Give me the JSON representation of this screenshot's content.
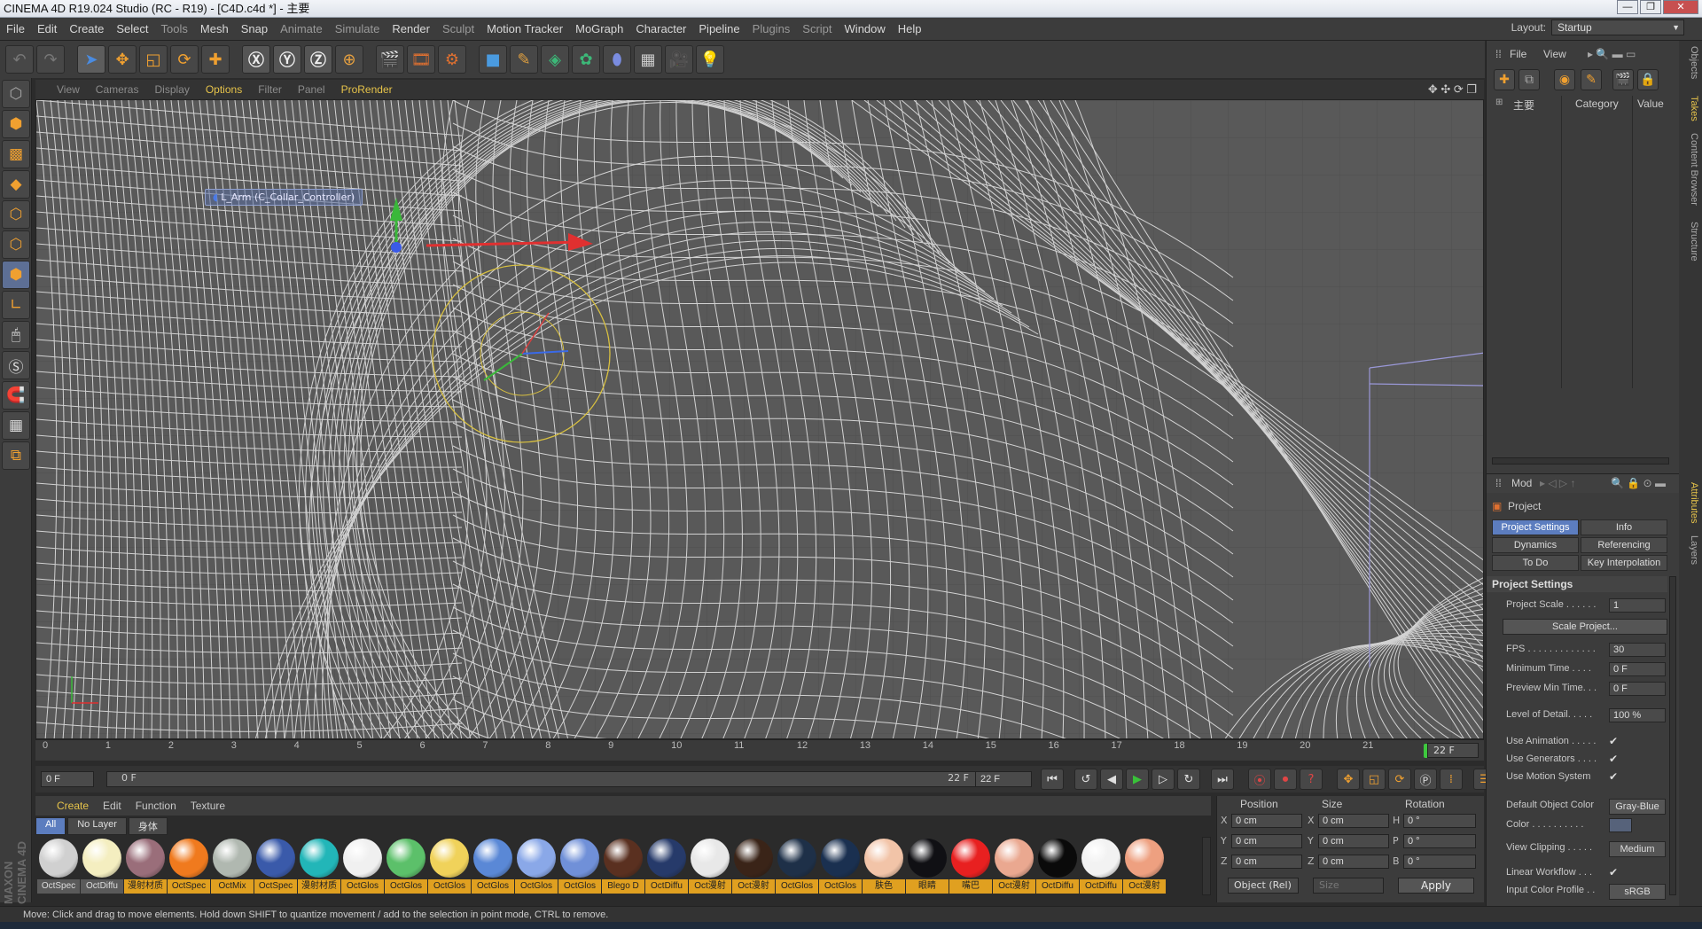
{
  "window": {
    "title": "CINEMA 4D R19.024 Studio (RC - R19) - [C4D.c4d *] - 主要",
    "controls": [
      "—",
      "❐",
      "✕"
    ]
  },
  "menubar": {
    "items": [
      "File",
      "Edit",
      "Create",
      "Select",
      "Tools",
      "Mesh",
      "Snap",
      "Animate",
      "Simulate",
      "Render",
      "Sculpt",
      "Motion Tracker",
      "MoGraph",
      "Character",
      "Pipeline",
      "Plugins",
      "Script",
      "Window",
      "Help"
    ],
    "layout_label": "Layout:",
    "layout_value": "Startup"
  },
  "viewport": {
    "menu": [
      "View",
      "Cameras",
      "Display",
      "Options",
      "Filter",
      "Panel",
      "ProRender"
    ],
    "object_label": "L_Arm (C_Collar_Controller)"
  },
  "timeline": {
    "ticks": [
      "0",
      "1",
      "2",
      "3",
      "4",
      "5",
      "6",
      "7",
      "8",
      "9",
      "10",
      "11",
      "12",
      "13",
      "14",
      "15",
      "16",
      "17",
      "18",
      "19",
      "20",
      "21"
    ],
    "current_frame": "22 F",
    "playhead_frame": 22,
    "max_frame": 22
  },
  "transport": {
    "start_field": "0 F",
    "range_start": "0 F",
    "range_end": "22 F",
    "end_field": "22 F"
  },
  "material_manager": {
    "menu": [
      "Create",
      "Edit",
      "Function",
      "Texture"
    ],
    "filters": [
      "All",
      "No Layer",
      "身体"
    ],
    "materials": [
      {
        "label": "OctSpec",
        "color": "#d0d0d0",
        "hl": false
      },
      {
        "label": "OctDiffu",
        "color": "#f4eec0",
        "hl": false
      },
      {
        "label": "漫射材质",
        "color": "#9a6e7a",
        "hl": true
      },
      {
        "label": "OctSpec",
        "color": "#f07a1e",
        "hl": true
      },
      {
        "label": "OctMix",
        "color": "#b0b8b0",
        "hl": true
      },
      {
        "label": "OctSpec",
        "color": "#3a5aaa",
        "hl": true
      },
      {
        "label": "漫射材质",
        "color": "#22b6b8",
        "hl": true
      },
      {
        "label": "OctGlos",
        "color": "#f0f0f0",
        "hl": true
      },
      {
        "label": "OctGlos",
        "color": "#5cc06a",
        "hl": true
      },
      {
        "label": "OctGlos",
        "color": "#f0d25a",
        "hl": true
      },
      {
        "label": "OctGlos",
        "color": "#5a88d6",
        "hl": true
      },
      {
        "label": "OctGlos",
        "color": "#8aa8e8",
        "hl": true
      },
      {
        "label": "OctGlos",
        "color": "#7090d8",
        "hl": true
      },
      {
        "label": "Blego D",
        "color": "#5a3020",
        "hl": true
      },
      {
        "label": "OctDiffu",
        "color": "#263a6a",
        "hl": true
      },
      {
        "label": "Oct漫射",
        "color": "#e8e8e8",
        "hl": true
      },
      {
        "label": "Oct漫射",
        "color": "#3a2418",
        "hl": true
      },
      {
        "label": "OctGlos",
        "color": "#1e3048",
        "hl": true
      },
      {
        "label": "OctGlos",
        "color": "#1a3050",
        "hl": true
      },
      {
        "label": "肤色",
        "color": "#f2c4a8",
        "hl": true
      },
      {
        "label": "眼睛",
        "color": "#101014",
        "hl": true
      },
      {
        "label": "嘴巴",
        "color": "#e82020",
        "hl": true
      },
      {
        "label": "Oct漫射",
        "color": "#eaa890",
        "hl": true
      },
      {
        "label": "OctDiffu",
        "color": "#0a0a0a",
        "hl": true
      },
      {
        "label": "OctDiffu",
        "color": "#f2f2f2",
        "hl": true
      },
      {
        "label": "Oct漫射",
        "color": "#eea080",
        "hl": true
      }
    ]
  },
  "coordinates": {
    "headers": [
      "Position",
      "Size",
      "Rotation"
    ],
    "rows": [
      {
        "a": "X",
        "pos": "0 cm",
        "b": "X",
        "size": "0 cm",
        "c": "H",
        "rot": "0 °"
      },
      {
        "a": "Y",
        "pos": "0 cm",
        "b": "Y",
        "size": "0 cm",
        "c": "P",
        "rot": "0 °"
      },
      {
        "a": "Z",
        "pos": "0 cm",
        "b": "Z",
        "size": "0 cm",
        "c": "B",
        "rot": "0 °"
      }
    ],
    "mode": "Object (Rel)",
    "size_mode": "Size",
    "apply": "Apply"
  },
  "objects_panel": {
    "menu": [
      "File",
      "View"
    ],
    "columns": [
      "主要",
      "Category",
      "Value"
    ]
  },
  "attributes": {
    "menu": "Mod",
    "object": "Project",
    "tabs": [
      "Project Settings",
      "Info",
      "Dynamics",
      "Referencing",
      "To Do",
      "Key Interpolation"
    ],
    "section": "Project Settings",
    "rows": [
      {
        "label": "Project Scale . . . . . .",
        "value": "1",
        "type": "field"
      },
      {
        "label": "FPS . . . . . . . . . . . . .",
        "value": "30",
        "type": "field"
      },
      {
        "label": "Minimum Time . . . .",
        "value": "0 F",
        "type": "field"
      },
      {
        "label": "Preview Min Time. . .",
        "value": "0 F",
        "type": "field"
      },
      {
        "label": "Level of Detail. . . . .",
        "value": "100 %",
        "type": "field"
      },
      {
        "label": "Use Animation . . . . .",
        "value": "✔",
        "type": "check"
      },
      {
        "label": "Use Generators . . . .",
        "value": "✔",
        "type": "check"
      },
      {
        "label": "Use Motion System",
        "value": "✔",
        "type": "check"
      },
      {
        "label": "Default Object Color",
        "value": "Gray-Blue",
        "type": "button"
      },
      {
        "label": "Color . . . . . . . . . .",
        "value": "",
        "type": "swatch"
      },
      {
        "label": "View Clipping . . . . .",
        "value": "Medium",
        "type": "button"
      },
      {
        "label": "Linear Workflow . . .",
        "value": "✔",
        "type": "check"
      },
      {
        "label": "Input Color Profile . .",
        "value": "sRGB",
        "type": "button"
      }
    ],
    "scale_button": "Scale Project..."
  },
  "side_tabs": [
    "Objects",
    "Takes",
    "Content Browser",
    "Structure",
    "Attributes",
    "Layers"
  ],
  "status": "Move: Click and drag to move elements. Hold down SHIFT to quantize movement / add to the selection in point mode, CTRL to remove.",
  "watermark": "MAXON CINEMA 4D"
}
